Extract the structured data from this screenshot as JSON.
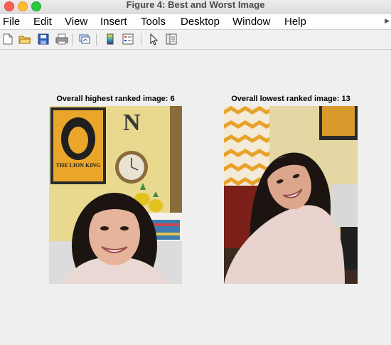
{
  "window": {
    "title": "Figure 4: Best and Worst Image"
  },
  "menu": {
    "items": [
      "File",
      "Edit",
      "View",
      "Insert",
      "Tools",
      "Desktop",
      "Window",
      "Help"
    ]
  },
  "toolbar": {
    "icons": [
      "new-figure-icon",
      "open-file-icon",
      "save-icon",
      "print-icon",
      "link-plot-icon",
      "insert-colorbar-icon",
      "insert-legend-icon",
      "edit-plot-icon",
      "property-inspector-icon"
    ]
  },
  "figures": [
    {
      "title": "Overall highest ranked image: 6",
      "poster_text": "THE LION KING"
    },
    {
      "title": "Overall lowest ranked image: 13"
    }
  ]
}
